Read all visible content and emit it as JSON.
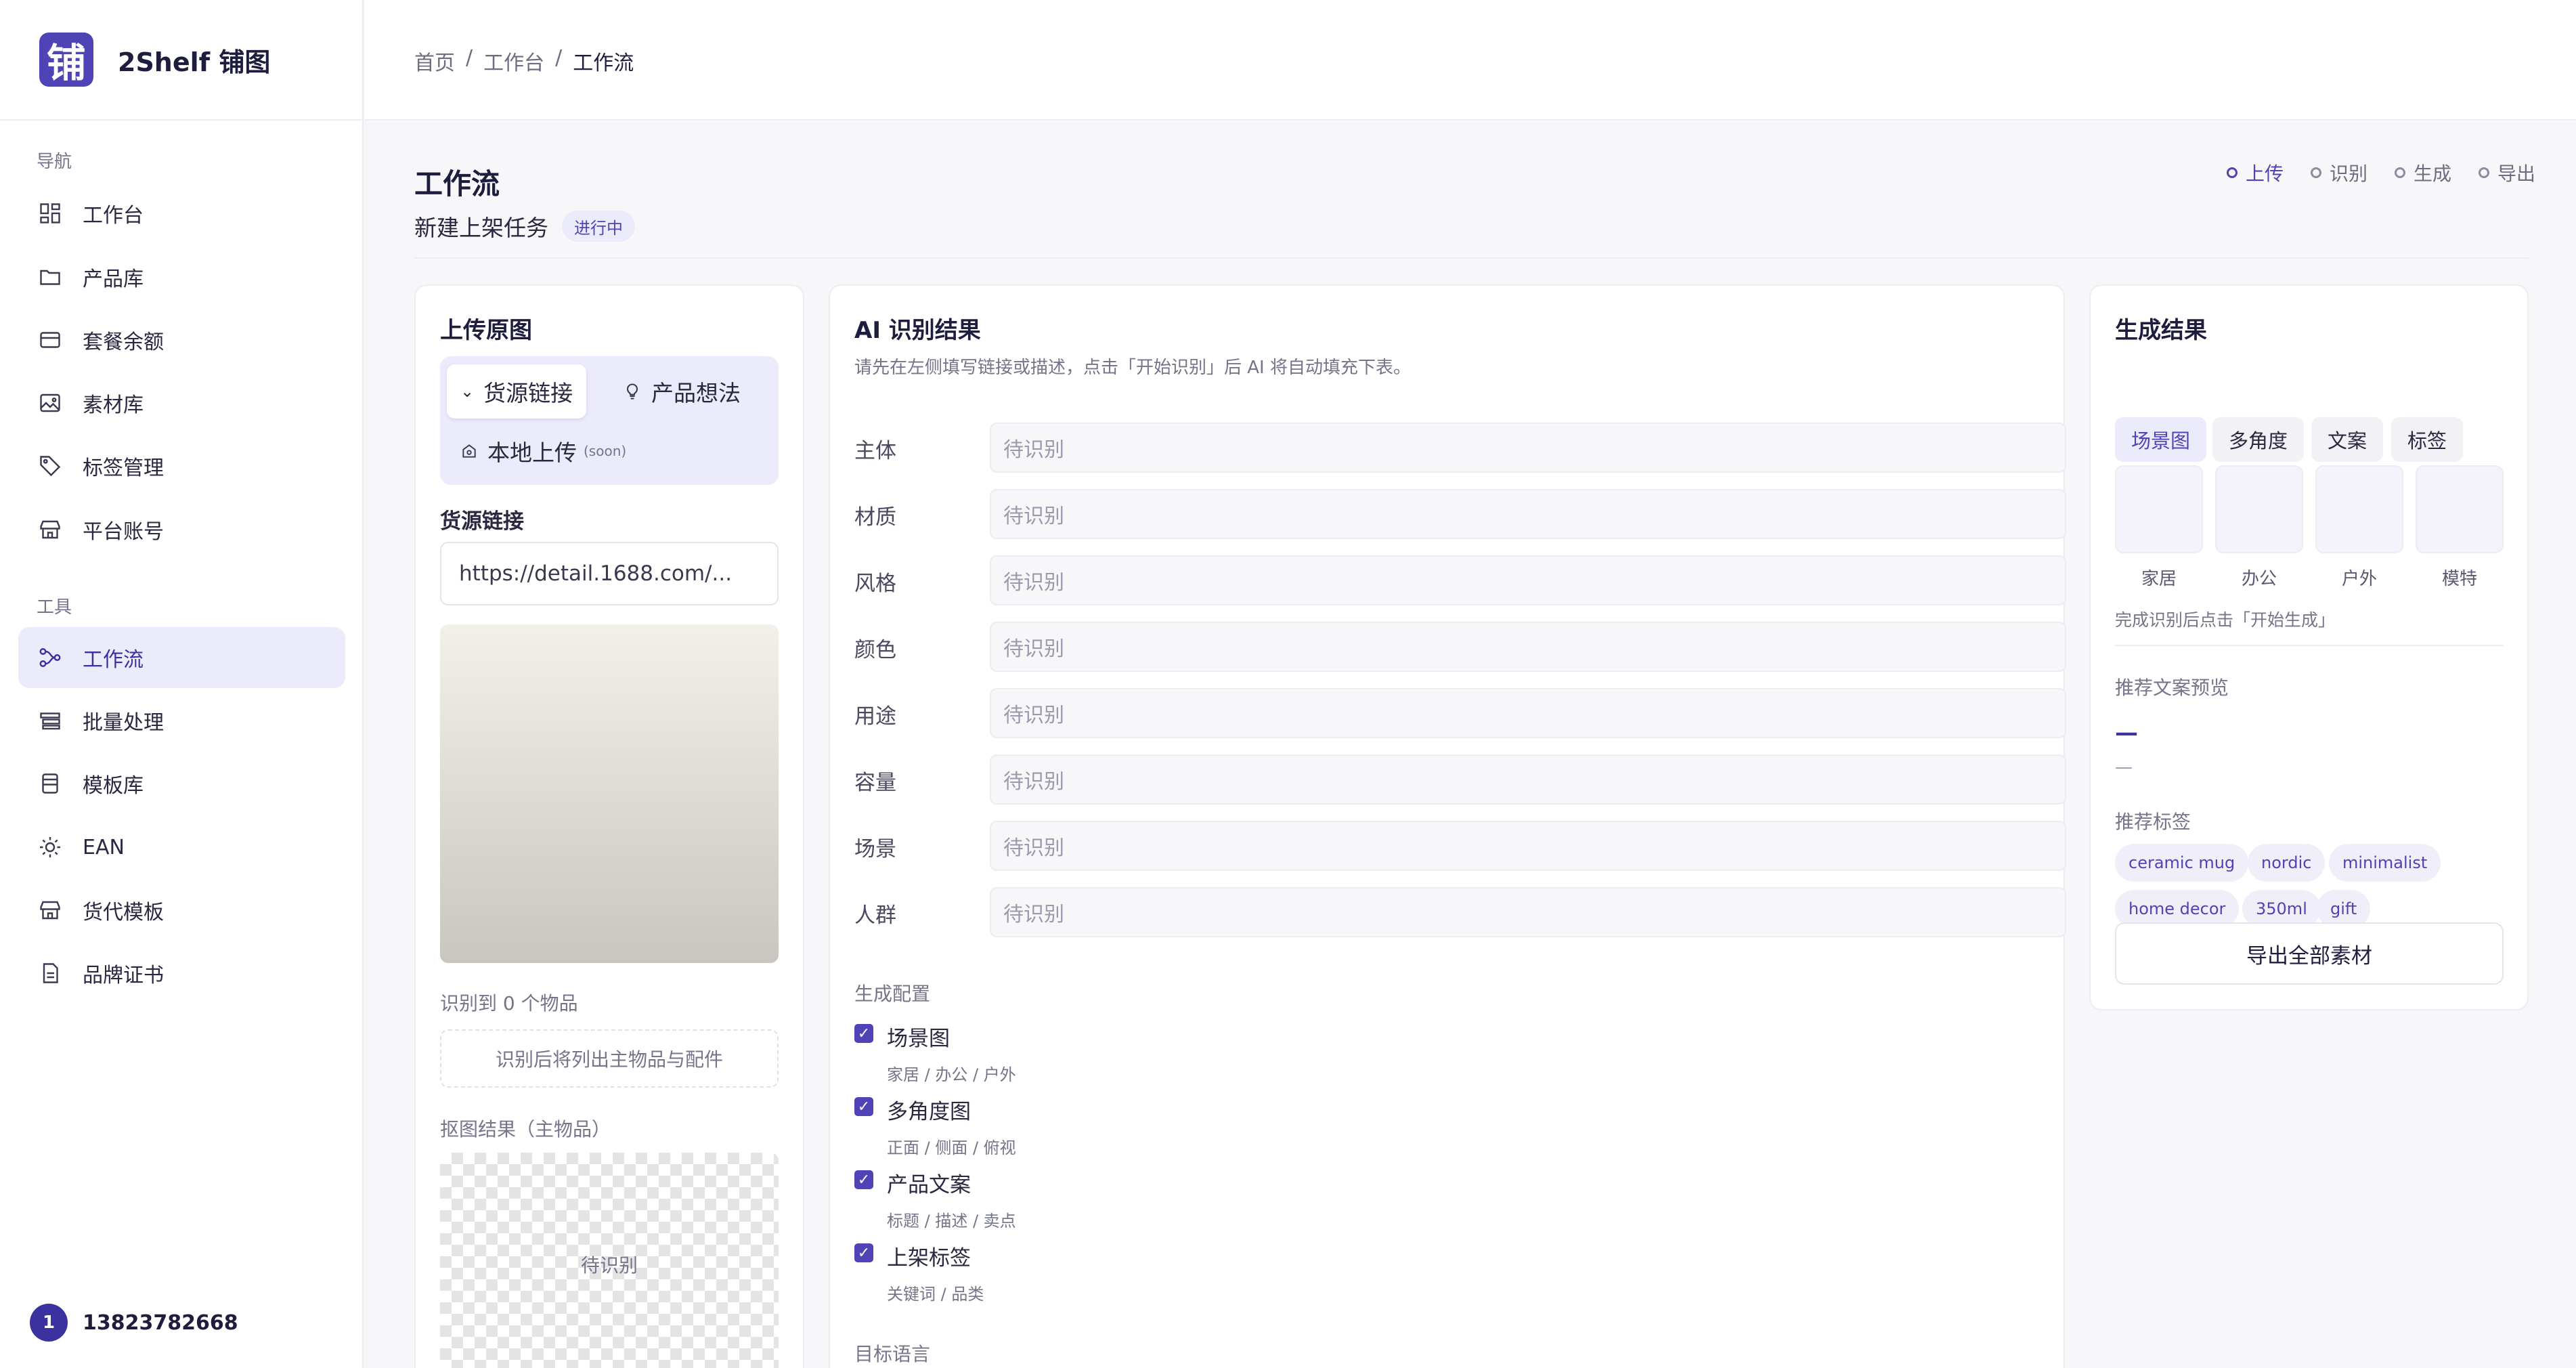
{
  "brand": {
    "logo_char": "铺",
    "name": "2Shelf 铺图"
  },
  "sidebar": {
    "nav_label": "导航",
    "nav_items": [
      {
        "label": "工作台",
        "icon": "dashboard-icon"
      },
      {
        "label": "产品库",
        "icon": "folder-icon"
      },
      {
        "label": "套餐余额",
        "icon": "card-icon"
      },
      {
        "label": "素材库",
        "icon": "image-icon"
      },
      {
        "label": "标签管理",
        "icon": "tag-icon"
      },
      {
        "label": "平台账号",
        "icon": "store-icon"
      }
    ],
    "tools_label": "工具",
    "tool_items": [
      {
        "label": "工作流",
        "icon": "workflow-icon",
        "active": true
      },
      {
        "label": "批量处理",
        "icon": "layers-icon"
      },
      {
        "label": "模板库",
        "icon": "template-icon"
      },
      {
        "label": "EAN",
        "icon": "sun-icon"
      },
      {
        "label": "货代模板",
        "icon": "store-icon"
      },
      {
        "label": "品牌证书",
        "icon": "document-icon"
      }
    ],
    "user": {
      "avatar_text": "1",
      "name": "13823782668"
    }
  },
  "breadcrumb": {
    "items": [
      "首页",
      "工作台",
      "工作流"
    ],
    "separator": "/"
  },
  "page": {
    "title": "工作流",
    "subtitle": "新建上架任务",
    "status": "进行中",
    "steps": [
      "上传",
      "识别",
      "生成",
      "导出"
    ],
    "active_step": "上传"
  },
  "upload": {
    "title": "上传原图",
    "modes": {
      "link": "货源链接",
      "idea": "产品想法",
      "local": "本地上传",
      "local_note": "(soon)"
    },
    "link_label": "货源链接",
    "link_placeholder": "https://detail.1688.com/...",
    "recognized_count": "识别到 0 个物品",
    "recognized_hint": "识别后将列出主物品与配件",
    "cutout_label": "抠图结果（主物品）",
    "cutout_status": "待识别"
  },
  "ai": {
    "title": "AI 识别结果",
    "hint": "请先在左侧填写链接或描述，点击「开始识别」后 AI 将自动填充下表。",
    "fields": [
      {
        "key": "主体",
        "value": "待识别"
      },
      {
        "key": "材质",
        "value": "待识别"
      },
      {
        "key": "风格",
        "value": "待识别"
      },
      {
        "key": "颜色",
        "value": "待识别"
      },
      {
        "key": "用途",
        "value": "待识别"
      },
      {
        "key": "容量",
        "value": "待识别"
      },
      {
        "key": "场景",
        "value": "待识别"
      },
      {
        "key": "人群",
        "value": "待识别"
      }
    ],
    "config_label": "生成配置",
    "config": [
      {
        "title": "场景图",
        "desc": "家居 / 办公 / 户外",
        "checked": true
      },
      {
        "title": "多角度图",
        "desc": "正面 / 侧面 / 俯视",
        "checked": true
      },
      {
        "title": "产品文案",
        "desc": "标题 / 描述 / 卖点",
        "checked": true
      },
      {
        "title": "上架标签",
        "desc": "关键词 / 品类",
        "checked": true
      }
    ],
    "language_label": "目标语言"
  },
  "result": {
    "title": "生成结果",
    "tabs": [
      "场景图",
      "多角度",
      "文案",
      "标签"
    ],
    "active_tab": "场景图",
    "thumbs": [
      "家居",
      "办公",
      "户外",
      "模特"
    ],
    "hint": "完成识别后点击「开始生成」",
    "copy_label": "推荐文案预览",
    "copy_title": "—",
    "copy_body": "—",
    "tags_label": "推荐标签",
    "tags": [
      "ceramic mug",
      "nordic",
      "minimalist",
      "home decor",
      "350ml",
      "gift"
    ],
    "export_button": "导出全部素材"
  },
  "colors": {
    "accent": "#4f43b6",
    "accent_bg": "#ecebfb",
    "text": "#1f1d3d"
  }
}
